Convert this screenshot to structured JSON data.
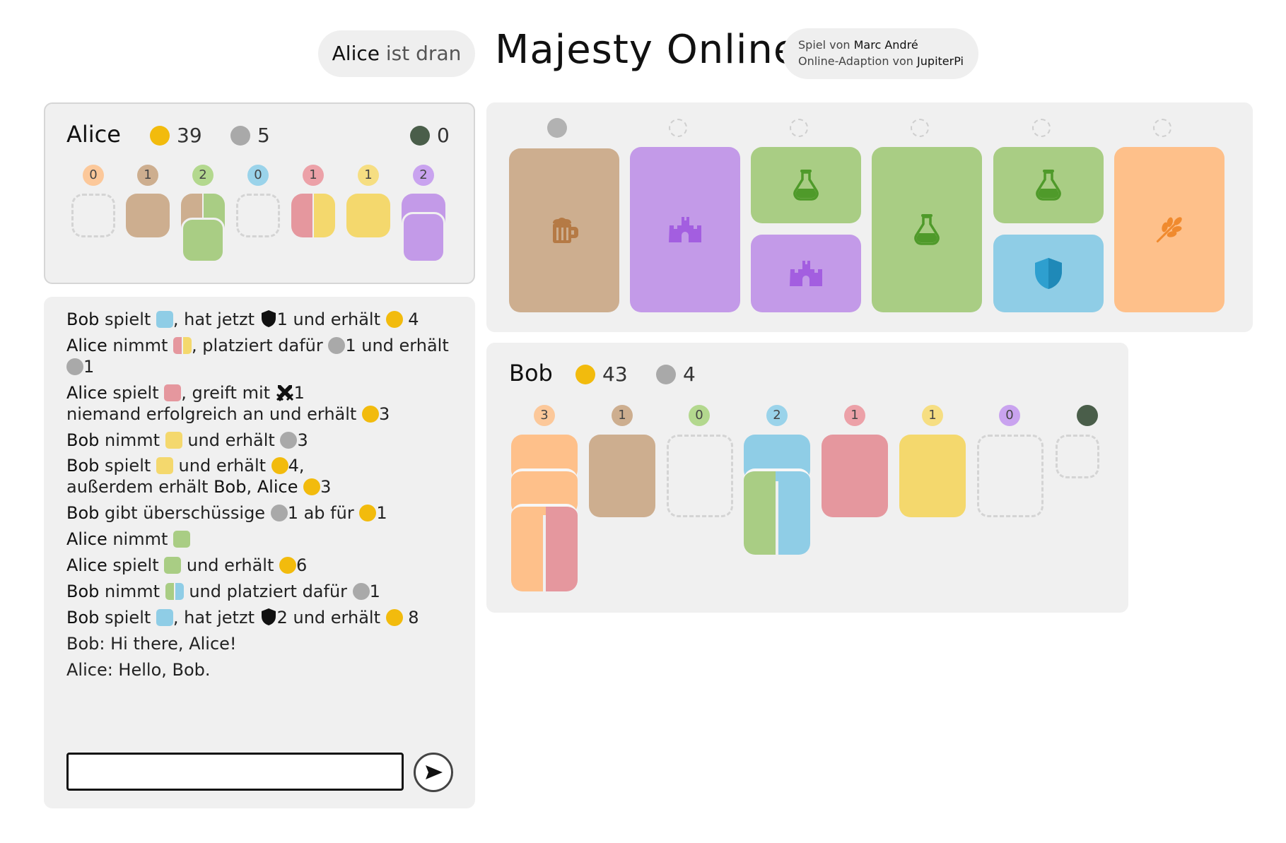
{
  "header": {
    "turn_name": "Alice",
    "turn_text": "ist dran",
    "title": "Majesty Online",
    "credit_line1_prefix": "Spiel von",
    "credit_line1_name": "Marc André",
    "credit_line2_prefix": "Online-Adaption von",
    "credit_line2_name": "JupiterPi"
  },
  "colors": {
    "coin": "#f2bb0d",
    "meeple": "#a9a9a9",
    "infirmary": "#4a5e4a",
    "brown": "#cdae8f",
    "purple": "#c39ae8",
    "green": "#a9cd84",
    "blue": "#8fcde6",
    "red": "#e5979e",
    "yellow": "#f4d86d",
    "orange": "#fec08a"
  },
  "alice": {
    "name": "Alice",
    "coins": "39",
    "meeples": "5",
    "infirmary": "0",
    "buildings": [
      {
        "color": "orange",
        "count": "0"
      },
      {
        "color": "brown",
        "count": "1"
      },
      {
        "color": "green",
        "count": "2"
      },
      {
        "color": "blue",
        "count": "0"
      },
      {
        "color": "red",
        "count": "1"
      },
      {
        "color": "yellow",
        "count": "1"
      },
      {
        "color": "purple",
        "count": "2"
      }
    ]
  },
  "bob": {
    "name": "Bob",
    "coins": "43",
    "meeples": "4",
    "buildings": [
      {
        "color": "orange",
        "count": "3"
      },
      {
        "color": "brown",
        "count": "1"
      },
      {
        "color": "green",
        "count": "0"
      },
      {
        "color": "blue",
        "count": "2"
      },
      {
        "color": "red",
        "count": "1"
      },
      {
        "color": "yellow",
        "count": "1"
      },
      {
        "color": "purple",
        "count": "0"
      },
      {
        "color": "infirmary",
        "count": ""
      }
    ]
  },
  "market": {
    "meeple_slots": [
      true,
      false,
      false,
      false,
      false,
      false
    ],
    "cards": [
      {
        "icon": "beer-mug-icon",
        "color": "brown"
      },
      {
        "icon": "castle-icon",
        "color": "purple"
      },
      {
        "icon": "potion-flask-icon",
        "color": "green",
        "bottom_icon": "castle-icon",
        "bottom_color": "purple"
      },
      {
        "icon": "potion-flask-icon",
        "color": "green"
      },
      {
        "icon": "potion-flask-icon",
        "color": "green",
        "bottom_icon": "shield-icon",
        "bottom_color": "blue"
      },
      {
        "icon": "wheat-icon",
        "color": "orange"
      }
    ]
  },
  "log": {
    "l1": {
      "a": "Bob",
      "b": " spielt ",
      "c": ", hat jetzt ",
      "d": "1 und erhält ",
      "e": " 4"
    },
    "l2": {
      "a": "Alice",
      "b": " nimmt ",
      "c": ", platziert dafür ",
      "d": "1 und erhält"
    },
    "l2b": {
      "a": "1"
    },
    "l3": {
      "a": "Alice",
      "b": " spielt ",
      "c": ", greift mit ",
      "d": "1"
    },
    "l3b": {
      "a": "niemand erfolgreich an und erhält ",
      "b": "3"
    },
    "l4": {
      "a": "Bob",
      "b": " nimmt ",
      "c": " und erhält ",
      "d": "3"
    },
    "l5": {
      "a": "Bob",
      "b": " spielt ",
      "c": " und erhält ",
      "d": "4,"
    },
    "l5b": {
      "a": "außerdem erhält ",
      "b": "Bob",
      "c": ", ",
      "d": "Alice",
      "e": "3"
    },
    "l6": {
      "a": "Bob",
      "b": " gibt überschüssige ",
      "c": "1 ab für ",
      "d": "1"
    },
    "l7": {
      "a": "Alice",
      "b": " nimmt "
    },
    "l8": {
      "a": "Alice",
      "b": " spielt ",
      "c": " und erhält ",
      "d": "6"
    },
    "l9": {
      "a": "Bob",
      "b": " nimmt ",
      "c": " und platziert dafür ",
      "d": "1"
    },
    "l10": {
      "a": "Bob",
      "b": " spielt ",
      "c": ", hat jetzt ",
      "d": "2 und erhält ",
      "e": " 8"
    },
    "l11": {
      "a": "Bob: Hi there, Alice!"
    },
    "l12": {
      "a": "Alice: Hello, Bob."
    }
  },
  "chat": {
    "placeholder": ""
  }
}
